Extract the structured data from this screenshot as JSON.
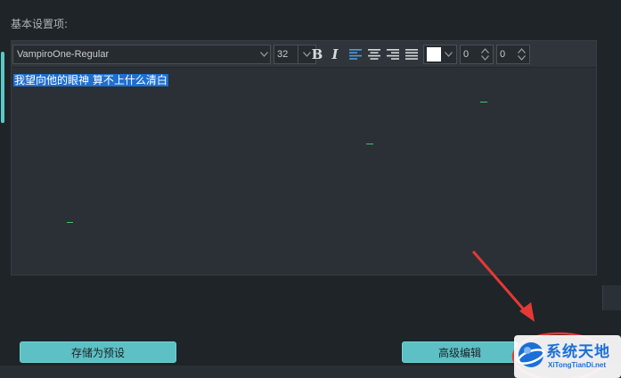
{
  "section_title": "基本设置项:",
  "toolbar": {
    "font_value": "VampiroOne-Regular",
    "size_value": "32",
    "bold_label": "B",
    "italic_label": "I",
    "color_value": "#ffffff",
    "spin1_value": "0",
    "spin2_value": "0"
  },
  "editor": {
    "selected_text": "我望向他的眼神 算不上什么清白"
  },
  "buttons": {
    "save_preset": "存储为预设",
    "advanced_edit": "高级编辑"
  },
  "watermark": {
    "title": "系统天地",
    "subtitle": "XiTongTianDi.net"
  },
  "colors": {
    "accent": "#5cc0c4",
    "selection": "#1f6fd0",
    "annotation": "#e53935",
    "watermark_blue": "#1b6fd6"
  }
}
